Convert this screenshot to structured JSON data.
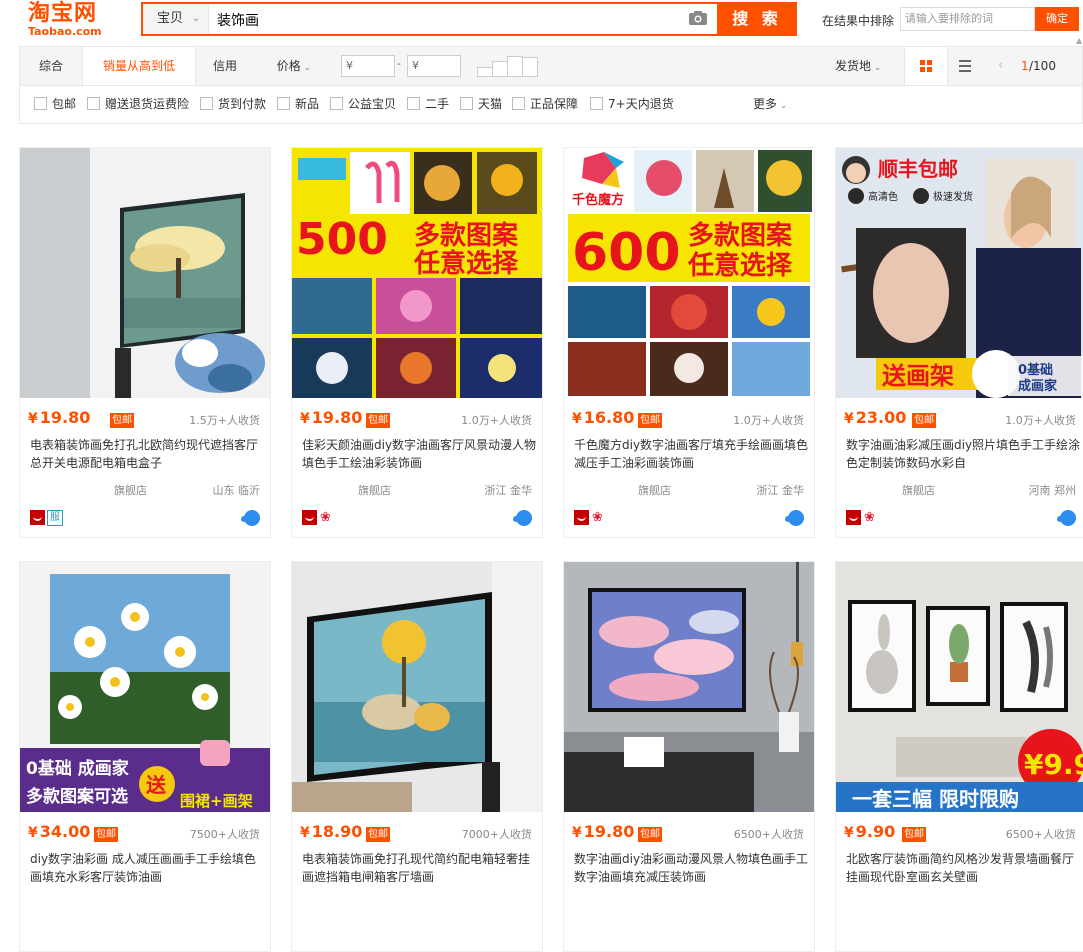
{
  "header": {
    "logo_cn": "淘宝网",
    "logo_en": "Taobao.com",
    "scope": "宝贝",
    "query": "装饰画",
    "search_label": "搜 索",
    "exclude_label": "在结果中排除",
    "exclude_placeholder": "请输入要排除的词",
    "exclude_confirm": "确定"
  },
  "sort": {
    "tabs": [
      "综合",
      "销量从高到低",
      "信用",
      "价格"
    ],
    "active_index": 1,
    "price_min_placeholder": "¥",
    "price_max_placeholder": "¥",
    "dash": "-",
    "ship_from": "发货地",
    "page_current": "1",
    "page_total": "/100"
  },
  "filters": {
    "items": [
      "包邮",
      "赠送退货运费险",
      "货到付款",
      "新品",
      "公益宝贝",
      "二手",
      "天猫",
      "正品保障",
      "7+天内退货"
    ],
    "more": "更多"
  },
  "products": [
    {
      "price": "19.80",
      "free_ship": "包邮",
      "sold": "1.5万+人收货",
      "title": "电表箱装饰画免打孔北欧简约现代遮挡客厅总开关电源配电箱电盒子",
      "shop": "旗舰店",
      "loc": "山东 临沂",
      "badges": [
        "tmall",
        "service"
      ]
    },
    {
      "price": "19.80",
      "free_ship": "包邮",
      "sold": "1.0万+人收货",
      "title": "佳彩天颜油画diy数字油画客厅风景动漫人物填色手工绘油彩装饰画",
      "shop": "旗舰店",
      "loc": "浙江 金华",
      "badges": [
        "tmall",
        "flower"
      ]
    },
    {
      "price": "16.80",
      "free_ship": "包邮",
      "sold": "1.0万+人收货",
      "title": "千色魔方diy数字油画客厅填充手绘画画填色减压手工油彩画装饰画",
      "shop": "旗舰店",
      "loc": "浙江 金华",
      "badges": [
        "tmall",
        "flower"
      ]
    },
    {
      "price": "23.00",
      "free_ship": "包邮",
      "sold": "1.0万+人收货",
      "title": "数字油画油彩减压画diy照片填色手工手绘涂色定制装饰数码水彩自",
      "shop": "旗舰店",
      "loc": "河南 郑州",
      "badges": [
        "tmall",
        "flower"
      ]
    },
    {
      "price": "34.00",
      "free_ship": "包邮",
      "sold": "7500+人收货",
      "title": "diy数字油彩画 成人减压画画手工手绘填色画填充水彩客厅装饰油画",
      "shop": "",
      "loc": "",
      "badges": []
    },
    {
      "price": "18.90",
      "free_ship": "包邮",
      "sold": "7000+人收货",
      "title": "电表箱装饰画免打孔现代简约配电箱轻奢挂画遮挡箱电闸箱客厅墙画",
      "shop": "",
      "loc": "",
      "badges": []
    },
    {
      "price": "19.80",
      "free_ship": "包邮",
      "sold": "6500+人收货",
      "title": "数字油画diy油彩画动漫风景人物填色画手工数字油画填充减压装饰画",
      "shop": "",
      "loc": "",
      "badges": []
    },
    {
      "price": "9.90",
      "free_ship": "包邮",
      "sold": "6500+人收货",
      "title": "北欧客厅装饰画简约风格沙发背景墙画餐厅挂画现代卧室画玄关壁画",
      "shop": "",
      "loc": "",
      "badges": []
    }
  ],
  "image_text": {
    "p2_num": "500",
    "p2_l1": "多款图案",
    "p2_l2": "任意选择",
    "p3_brand": "千色魔方",
    "p3_num": "600",
    "p3_l1": "多款图案",
    "p3_l2": "任意选择",
    "p4_top": "顺丰包邮",
    "p4_hd": "高清色",
    "p4_fast": "极速发货",
    "p4_bottom": "送画架",
    "p4_zero": "0基础",
    "p4_zero2": "成画家",
    "p5_l1": "0基础 成画家",
    "p5_l2": "多款图案可选",
    "p5_song": "送",
    "p5_gift": "围裙+画架",
    "p8_price": "¥9.9",
    "p8_bottom": "一套三幅  限时限购"
  },
  "colors": {
    "accent": "#ff5000",
    "tmall": "#c40000"
  }
}
